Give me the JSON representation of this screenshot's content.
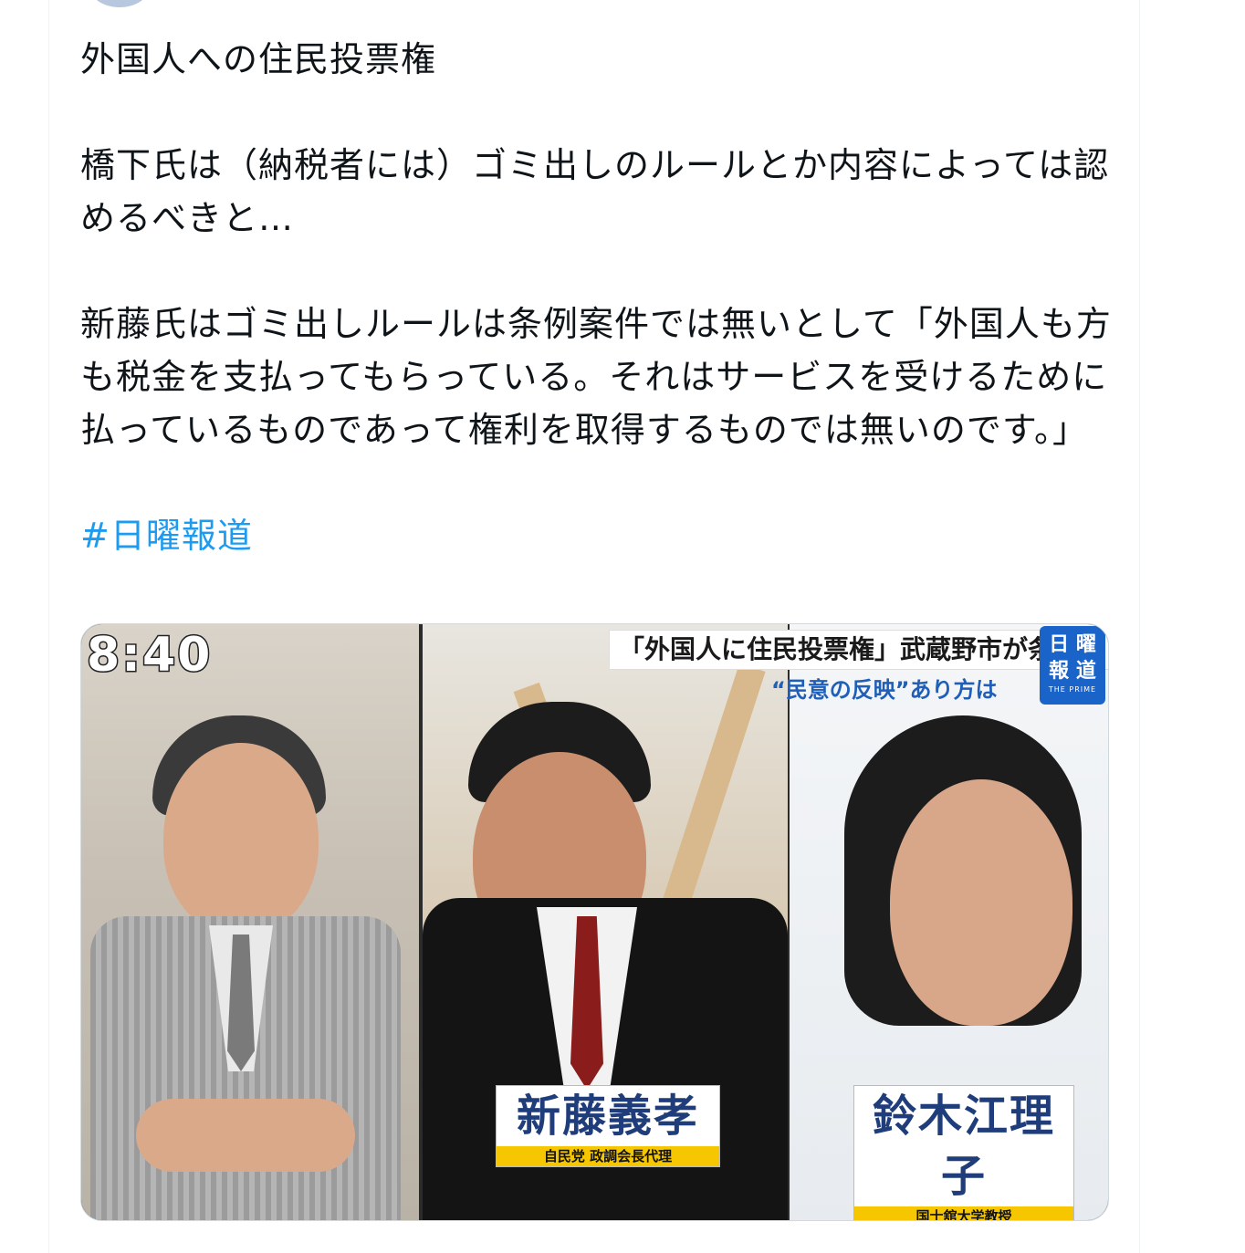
{
  "tweet": {
    "line1": "外国人への住民投票権",
    "para2": "橋下氏は（納税者には）ゴミ出しのルールとか内容によっては認めるべきと…",
    "para3": "新藤氏はゴミ出しルールは条例案件では無いとして「外国人も方も税金を支払ってもらっている。それはサービスを受けるために払っているものであって権利を取得するものでは無いのです。」",
    "hashtag": "#日曜報道"
  },
  "media": {
    "clock": "8:40",
    "headline": "「外国人に住民投票権」武蔵野市が条例案",
    "subheadline": "“民意の反映”あり方は",
    "logo": {
      "line1": "日 曜",
      "line2": "報 道",
      "line3": "THE PRIME"
    },
    "guest2": {
      "name": "新藤義孝",
      "title": "自民党 政調会長代理"
    },
    "guest3": {
      "name": "鈴木江理子",
      "title": "国士舘大学教授"
    }
  },
  "colors": {
    "hashtag": "#1d9bf0",
    "caption_bar": "#f6c700",
    "logo_bg": "#1a63c8"
  }
}
